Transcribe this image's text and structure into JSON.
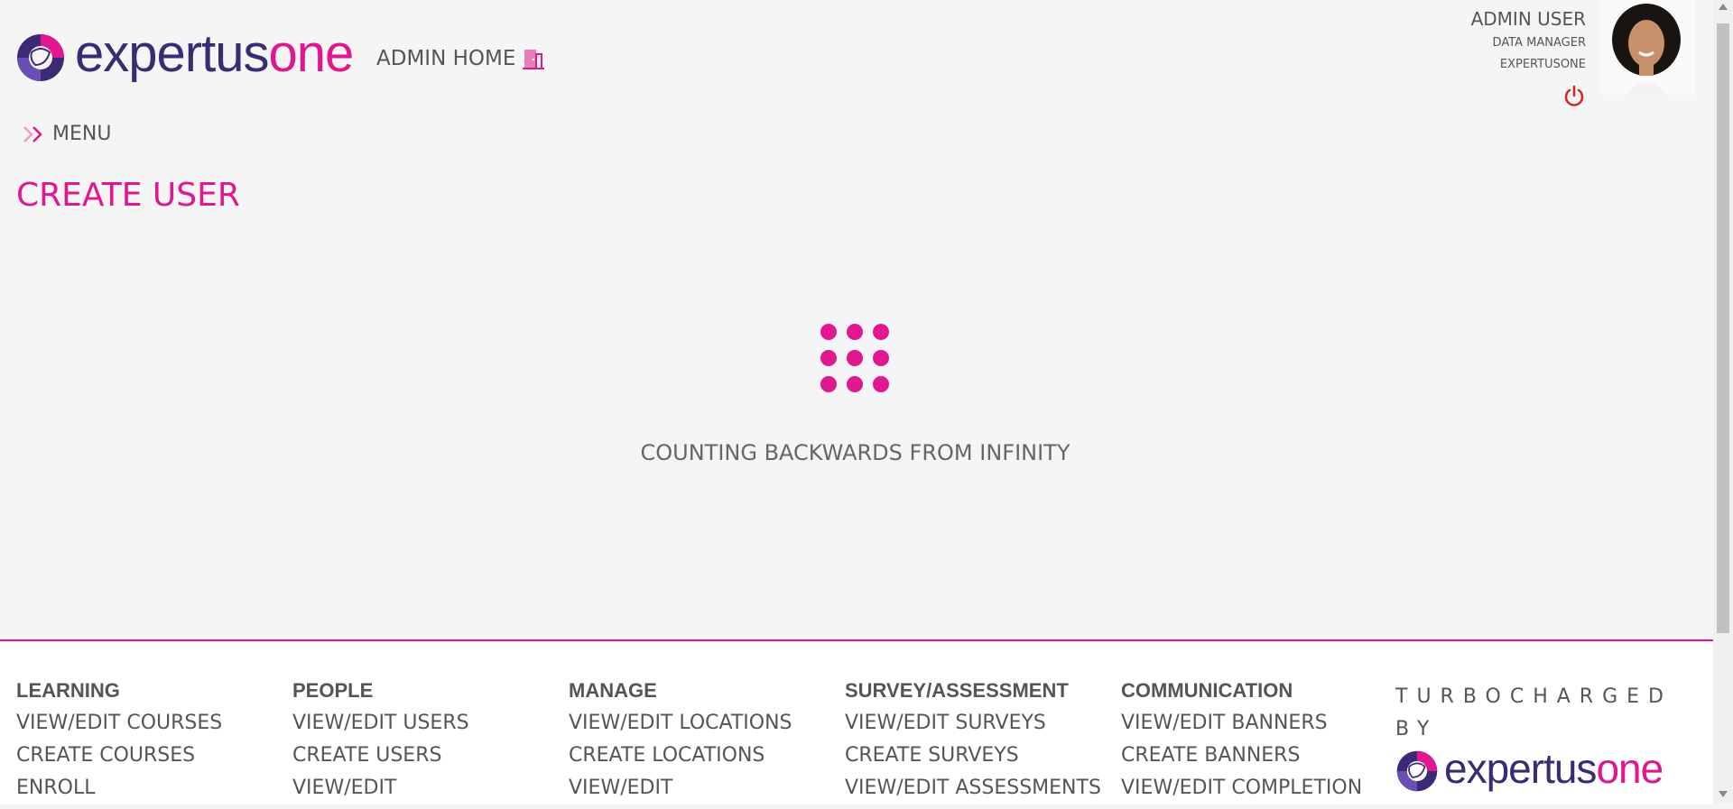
{
  "header": {
    "logo_part1": "expertus",
    "logo_part2": "one",
    "admin_home": "ADMIN HOME",
    "user_name": "ADMIN USER",
    "user_role": "DATA MANAGER",
    "user_org": "EXPERTUSONE"
  },
  "menu": {
    "label": "MENU"
  },
  "page": {
    "title": "CREATE USER",
    "loading_text": "COUNTING BACKWARDS FROM INFINITY"
  },
  "footer": {
    "columns": [
      {
        "heading": "LEARNING",
        "links": [
          "VIEW/EDIT COURSES",
          "CREATE COURSES",
          "ENROLL"
        ]
      },
      {
        "heading": "PEOPLE",
        "links": [
          "VIEW/EDIT USERS",
          "CREATE USERS",
          "VIEW/EDIT"
        ]
      },
      {
        "heading": "MANAGE",
        "links": [
          "VIEW/EDIT LOCATIONS",
          "CREATE LOCATIONS",
          "VIEW/EDIT"
        ]
      },
      {
        "heading": "SURVEY/ASSESSMENT",
        "links": [
          "VIEW/EDIT SURVEYS",
          "CREATE SURVEYS",
          "VIEW/EDIT ASSESSMENTS"
        ]
      },
      {
        "heading": "COMMUNICATION",
        "links": [
          "VIEW/EDIT BANNERS",
          "CREATE BANNERS",
          "VIEW/EDIT COMPLETION"
        ]
      }
    ],
    "turbocharged": "TURBOCHARGED BY",
    "logo_part1": "expertus",
    "logo_part2": "one"
  },
  "icons": {
    "logo": "expertusone-logo-icon",
    "admin_home": "door-icon",
    "menu": "double-chevron-right-icon",
    "logout": "power-icon",
    "spinner": "dot-grid-spinner-icon"
  },
  "colors": {
    "brand_pink": "#e0188f",
    "brand_purple": "#3b2a74",
    "power_red": "#e02020"
  }
}
